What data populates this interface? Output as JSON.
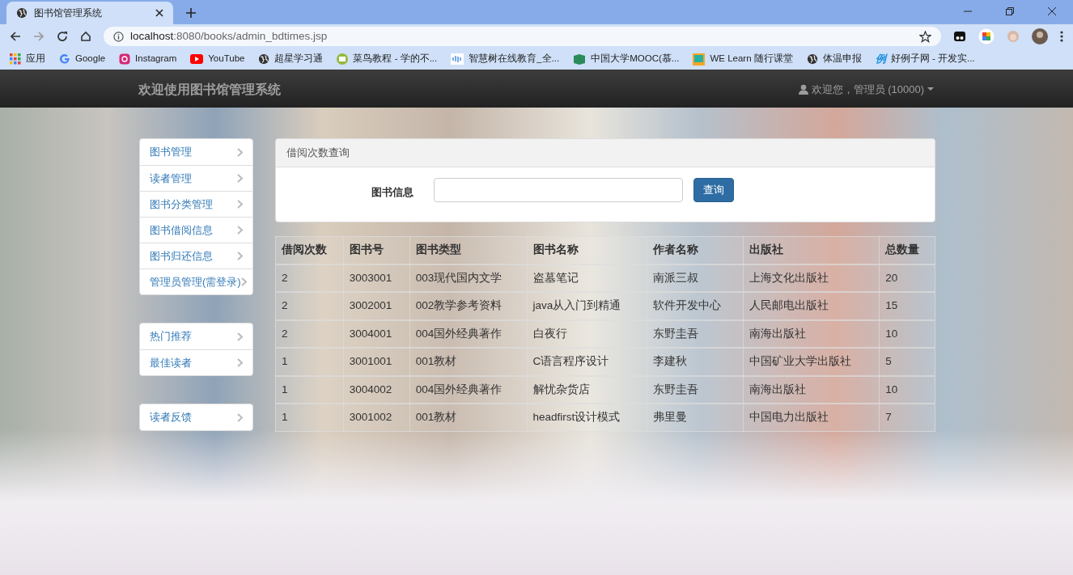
{
  "browser": {
    "tab_title": "图书馆管理系统",
    "url_host": "localhost",
    "url_path": ":8080/books/admin_bdtimes.jsp",
    "bookmarks": [
      {
        "label": "应用",
        "kind": "apps"
      },
      {
        "label": "Google",
        "kind": "google"
      },
      {
        "label": "Instagram",
        "kind": "instagram"
      },
      {
        "label": "YouTube",
        "kind": "youtube"
      },
      {
        "label": "超星学习通",
        "kind": "globe"
      },
      {
        "label": "菜鸟教程 - 学的不...",
        "kind": "runoob"
      },
      {
        "label": "智慧树在线教育_全...",
        "kind": "zhihuishu"
      },
      {
        "label": "中国大学MOOC(慕...",
        "kind": "mooc"
      },
      {
        "label": "WE Learn 随行课堂",
        "kind": "welearn"
      },
      {
        "label": "体温申报",
        "kind": "globe"
      },
      {
        "label": "好例子网 - 开发实...",
        "kind": "haolizi",
        "icon_text": "例"
      }
    ]
  },
  "navbar": {
    "brand": "欢迎使用图书馆管理系统",
    "user": "欢迎您，管理员 (10000)"
  },
  "sidebar": {
    "groups": [
      [
        {
          "label": "图书管理"
        },
        {
          "label": "读者管理"
        },
        {
          "label": "图书分类管理"
        },
        {
          "label": "图书借阅信息"
        },
        {
          "label": "图书归还信息"
        },
        {
          "label": "管理员管理(需登录)"
        }
      ],
      [
        {
          "label": "热门推荐"
        },
        {
          "label": "最佳读者"
        }
      ],
      [
        {
          "label": "读者反馈"
        }
      ]
    ]
  },
  "search_panel": {
    "title": "借阅次数查询",
    "field_label": "图书信息",
    "button": "查询"
  },
  "table": {
    "columns": [
      "借阅次数",
      "图书号",
      "图书类型",
      "图书名称",
      "作者名称",
      "出版社",
      "总数量"
    ],
    "rows": [
      [
        "2",
        "3003001",
        "003现代国内文学",
        "盗墓笔记",
        "南派三叔",
        "上海文化出版社",
        "20"
      ],
      [
        "2",
        "3002001",
        "002教学参考资料",
        "java从入门到精通",
        "软件开发中心",
        "人民邮电出版社",
        "15"
      ],
      [
        "2",
        "3004001",
        "004国外经典著作",
        "白夜行",
        "东野圭吾",
        "南海出版社",
        "10"
      ],
      [
        "1",
        "3001001",
        "001教材",
        "C语言程序设计",
        "李建秋",
        "中国矿业大学出版社",
        "5"
      ],
      [
        "1",
        "3004002",
        "004国外经典著作",
        "解忧杂货店",
        "东野圭吾",
        "南海出版社",
        "10"
      ],
      [
        "1",
        "3001002",
        "001教材",
        "headfirst设计模式",
        "弗里曼",
        "中国电力出版社",
        "7"
      ]
    ]
  }
}
